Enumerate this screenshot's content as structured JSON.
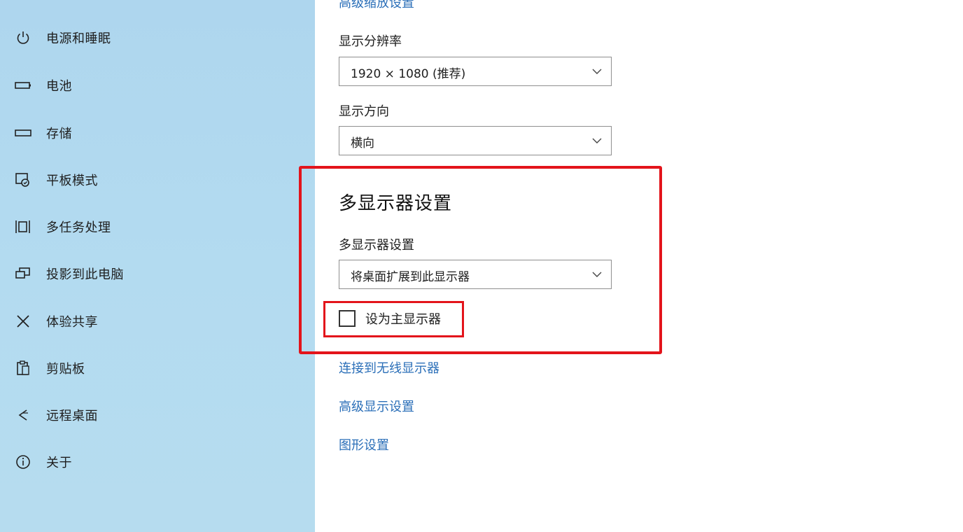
{
  "sidebar": {
    "items": [
      {
        "label": "电源和睡眠",
        "icon": "power-icon"
      },
      {
        "label": "电池",
        "icon": "battery-icon"
      },
      {
        "label": "存储",
        "icon": "storage-icon"
      },
      {
        "label": "平板模式",
        "icon": "tablet-mode-icon"
      },
      {
        "label": "多任务处理",
        "icon": "multitasking-icon"
      },
      {
        "label": "投影到此电脑",
        "icon": "project-icon"
      },
      {
        "label": "体验共享",
        "icon": "shared-experiences-icon"
      },
      {
        "label": "剪贴板",
        "icon": "clipboard-icon"
      },
      {
        "label": "远程桌面",
        "icon": "remote-desktop-icon"
      },
      {
        "label": "关于",
        "icon": "info-icon"
      }
    ]
  },
  "main": {
    "top_link": "高级缩放设置",
    "resolution": {
      "label": "显示分辨率",
      "value": "1920 × 1080 (推荐)"
    },
    "orientation": {
      "label": "显示方向",
      "value": "横向"
    },
    "multi_display": {
      "title": "多显示器设置",
      "label": "多显示器设置",
      "value": "将桌面扩展到此显示器",
      "make_main_label": "设为主显示器",
      "make_main_checked": false
    },
    "links": {
      "wireless": "连接到无线显示器",
      "advanced": "高级显示设置",
      "graphics": "图形设置"
    }
  },
  "colors": {
    "sidebar_bg": "#b3dbf0",
    "link": "#2b6fb8",
    "highlight": "#e3141b"
  }
}
